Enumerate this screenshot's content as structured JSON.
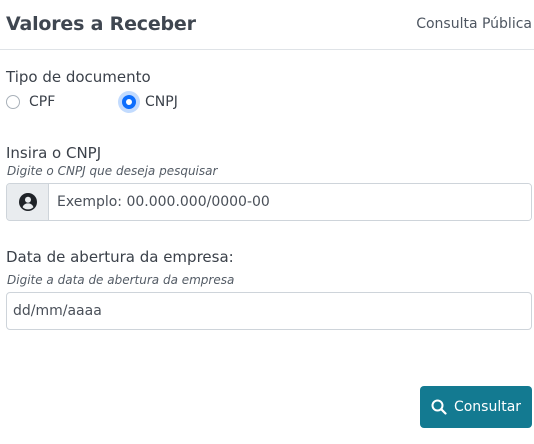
{
  "header": {
    "title": "Valores a Receber",
    "subtitle": "Consulta Pública"
  },
  "tipo_documento": {
    "label": "Tipo de documento",
    "options": [
      {
        "label": "CPF",
        "checked": false
      },
      {
        "label": "CNPJ",
        "checked": true
      }
    ]
  },
  "cnpj": {
    "label": "Insira o CNPJ",
    "hint": "Digite o CNPJ que deseja pesquisar",
    "placeholder": "Exemplo: 00.000.000/0000-00",
    "value": "",
    "icon": "user-circle-icon"
  },
  "data_abertura": {
    "label": "Data de abertura da empresa:",
    "hint": "Digite a data de abertura da empresa",
    "placeholder": "dd/mm/aaaa",
    "value": ""
  },
  "submit": {
    "label": "Consultar",
    "icon": "search-icon"
  },
  "colors": {
    "accent": "#137a91",
    "radio_checked": "#0d6efd"
  }
}
